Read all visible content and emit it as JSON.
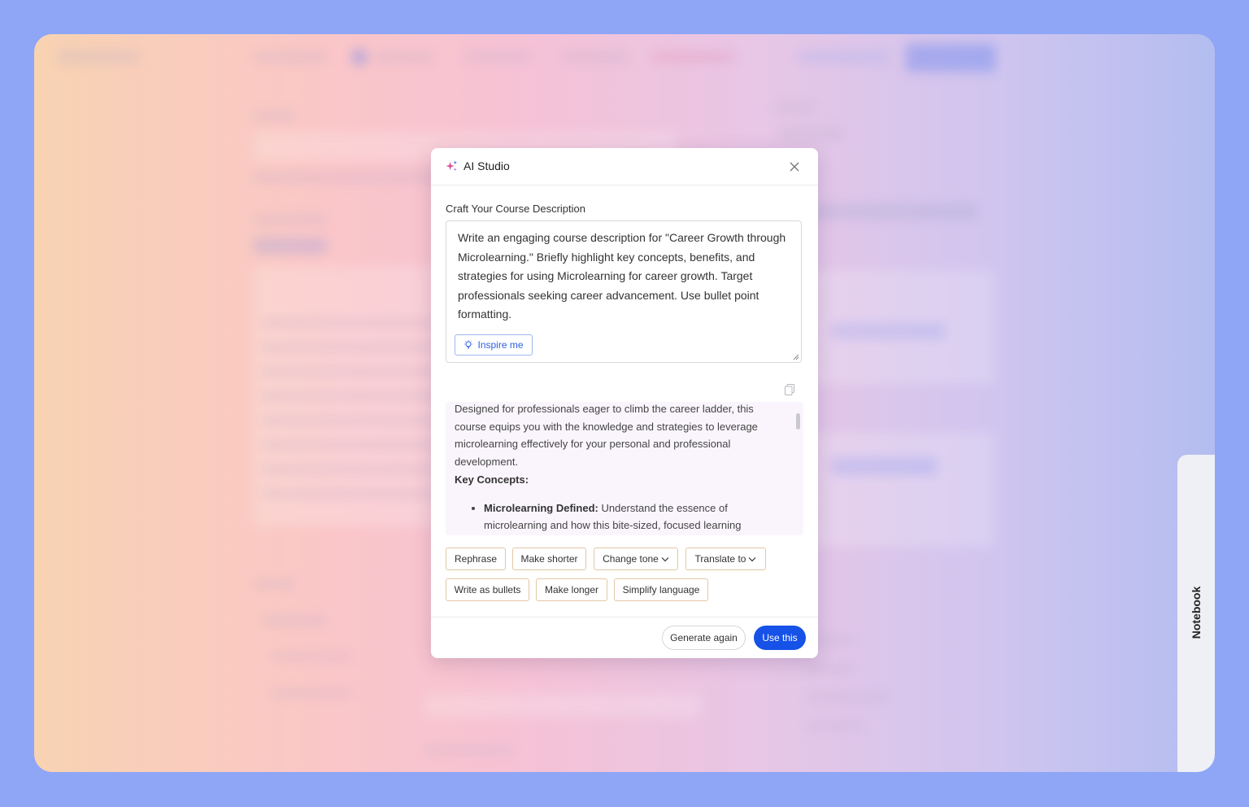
{
  "modal": {
    "title": "AI Studio",
    "section_label": "Craft Your Course Description",
    "prompt_text": "Write an engaging course description for \"Career Growth through Microlearning.\" Briefly highlight key concepts, benefits, and strategies for using Microlearning for career growth. Target professionals seeking career advancement. Use bullet point formatting.",
    "inspire_label": "Inspire me",
    "result": {
      "intro": "Designed for professionals eager to climb the career ladder, this course equips you with the knowledge and strategies to leverage microlearning effectively for your personal and professional development.",
      "heading": "Key Concepts:",
      "bullets": [
        {
          "term": "Microlearning Defined:",
          "text": " Understand the essence of microlearning and how this bite-sized, focused learning"
        }
      ]
    },
    "actions": {
      "rephrase": "Rephrase",
      "make_shorter": "Make shorter",
      "change_tone": "Change tone",
      "translate_to": "Translate to",
      "write_as_bullets": "Write as bullets",
      "make_longer": "Make longer",
      "simplify_language": "Simplify language"
    },
    "footer": {
      "generate_again": "Generate again",
      "use_this": "Use this"
    }
  },
  "side_tab": {
    "label": "Notebook"
  },
  "colors": {
    "primary": "#1652e8",
    "accent_link": "#2d5fe0",
    "chip_border": "#e3c7a4"
  }
}
